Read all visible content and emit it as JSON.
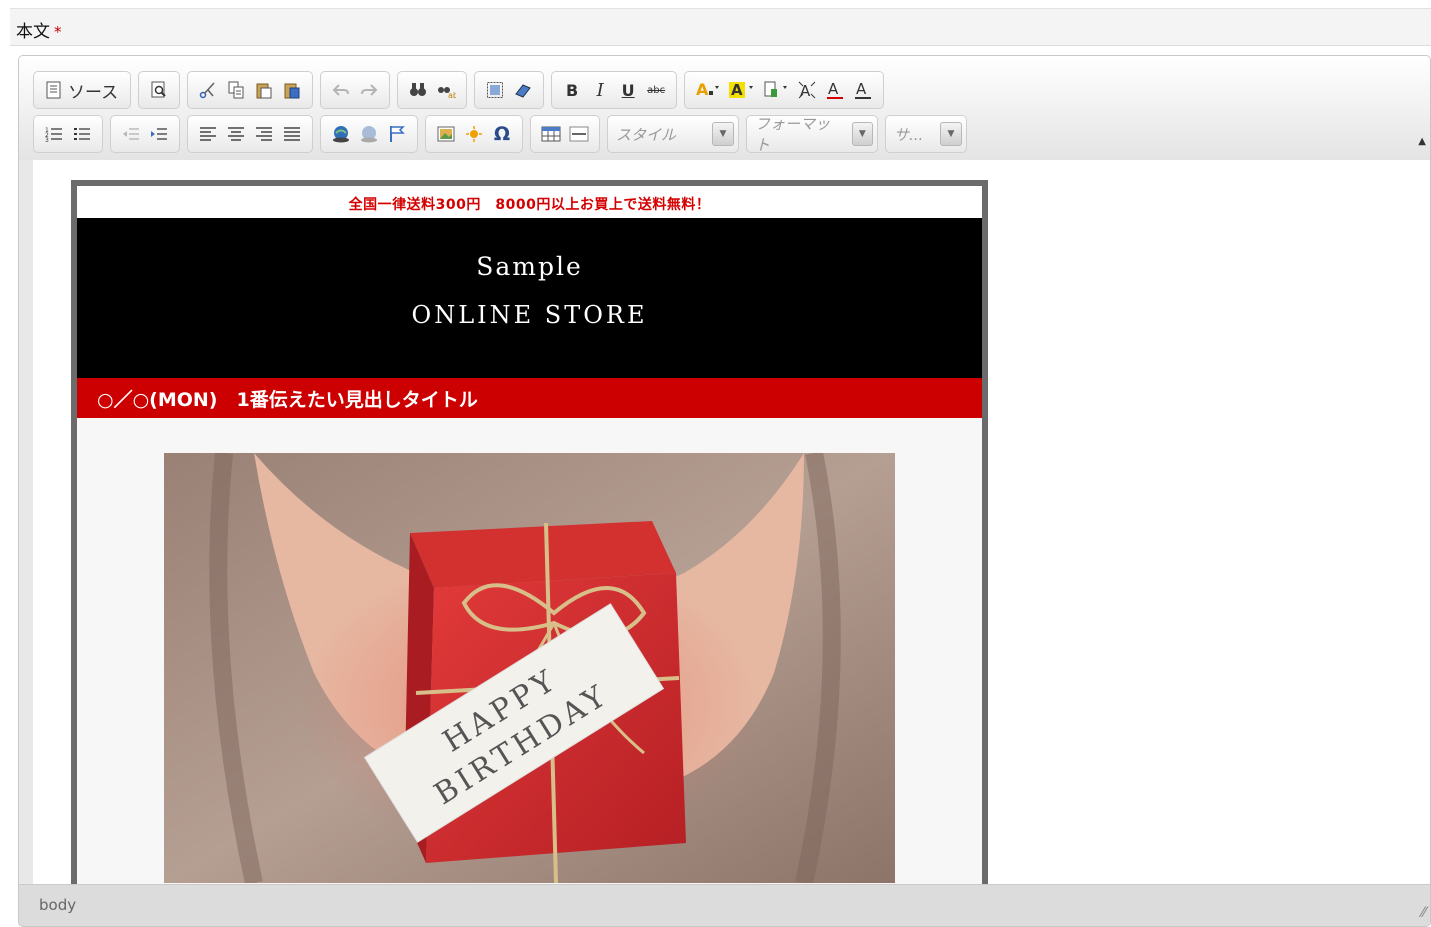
{
  "field": {
    "label": "本文",
    "required_mark": "*"
  },
  "toolbar": {
    "source_label": "ソース",
    "style_combo": "スタイル",
    "format_combo": "フォーマット",
    "size_combo": "サ..."
  },
  "content": {
    "notice": "全国一律送料300円　8000円以上お買上で送料無料！",
    "banner_line1": "Sample",
    "banner_line2": "ONLINE STORE",
    "headline": "○／○(MON)　1番伝えたい見出しタイトル",
    "gift_tag_line1": "HAPPY",
    "gift_tag_line2": "BIRTHDAY",
    "colors": {
      "notice": "#d40000",
      "headline_bg": "#cc0000",
      "banner_bg": "#000000",
      "gift_box": "#d62b2b"
    }
  },
  "statusbar": {
    "path": "body"
  },
  "icons": {
    "row1": [
      "source-icon",
      "preview-icon",
      "cut-icon",
      "copy-icon",
      "paste-icon",
      "paste-text-icon",
      "paste-word-icon",
      "undo-icon",
      "redo-icon",
      "find-icon",
      "replace-icon",
      "select-all-icon",
      "remove-format-icon",
      "bold-icon",
      "italic-icon",
      "underline-icon",
      "strike-icon",
      "text-color-icon",
      "bg-color-icon",
      "show-blocks-icon",
      "maximize-icon",
      "font-size-up-icon",
      "font-size-down-icon"
    ],
    "row2": [
      "numbered-list-icon",
      "bulleted-list-icon",
      "outdent-icon",
      "indent-icon",
      "align-left-icon",
      "align-center-icon",
      "align-right-icon",
      "justify-icon",
      "link-icon",
      "unlink-icon",
      "anchor-icon",
      "image-icon",
      "flash-icon",
      "special-char-icon",
      "table-icon",
      "horizontal-rule-icon"
    ]
  }
}
